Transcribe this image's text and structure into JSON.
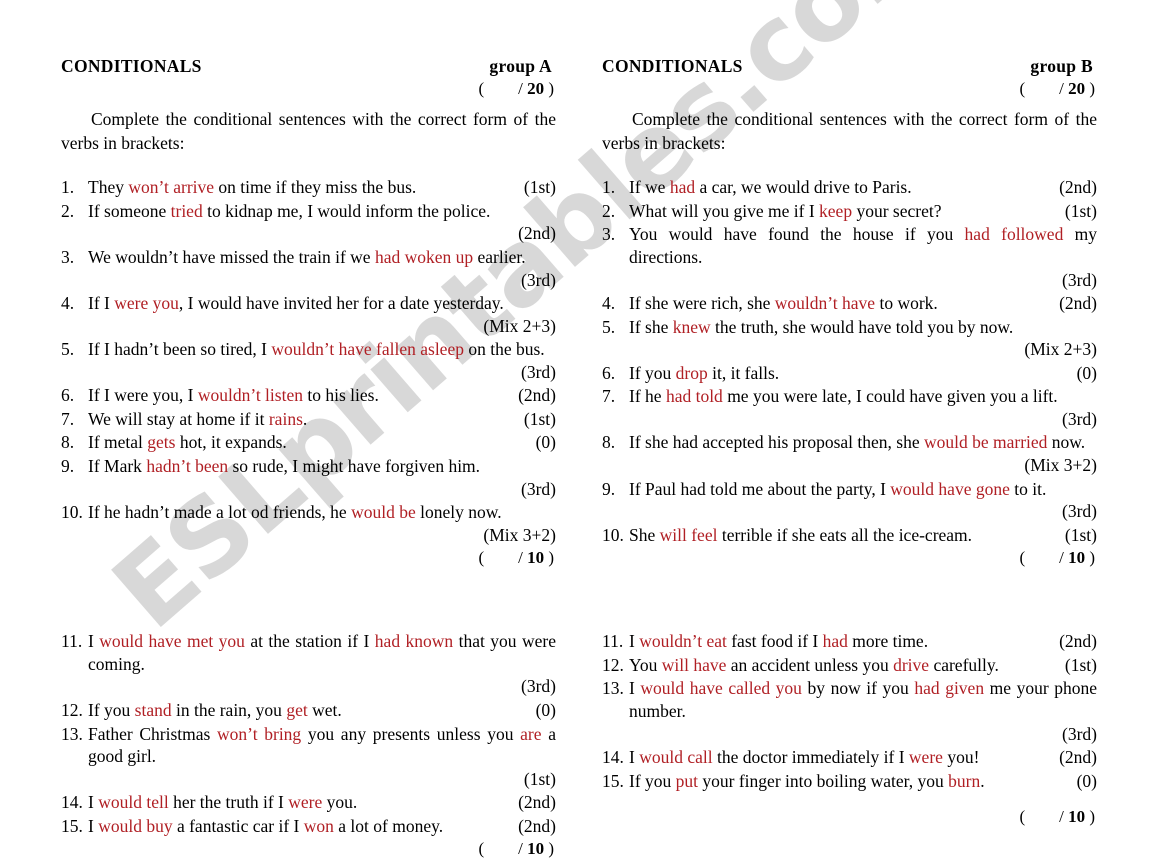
{
  "watermark": {
    "text": "ESLprintables.com"
  },
  "colors": {
    "answer_red": "#b01f24",
    "text_black": "#000000",
    "watermark_gray": "#d2d2d2"
  },
  "columns": [
    {
      "id": "group-a",
      "title": "CONDITIONALS",
      "group_label": "group A",
      "total_score": "(        / 20 )",
      "total_score_prefix": "(        / ",
      "total_score_num": "20",
      "total_score_suffix": " )",
      "instructions": "Complete the conditional sentences with the correct form of the verbs in brackets:",
      "block1": {
        "items": [
          {
            "num": "1.",
            "layout": "single",
            "text_html": "They <span class='ans'>won’t arrive</span> on time if they miss the bus.",
            "tag": "(1st)"
          },
          {
            "num": "2.",
            "layout": "wrap",
            "text_html": "If someone <span class='ans'>tried</span> to kidnap me, I would inform the police.",
            "tag": "(2nd)"
          },
          {
            "num": "3.",
            "layout": "wrap",
            "text_html": "We wouldn’t have missed the train if we <span class='ans'>had woken up</span> earlier.",
            "tag": "(3rd)"
          },
          {
            "num": "4.",
            "layout": "wrap",
            "text_html": "If I <span class='ans'>were you</span>, I would have invited her for a date yesterday.",
            "tag": "(Mix 2+3)"
          },
          {
            "num": "5.",
            "layout": "wrap",
            "text_html": "If I hadn’t been so tired, I <span class='ans'>wouldn’t have fallen asleep</span> on the bus.",
            "tag": "(3rd)"
          },
          {
            "num": "6.",
            "layout": "single",
            "text_html": "If I were you, I <span class='ans'>wouldn’t listen</span> to his lies.",
            "tag": "(2nd)"
          },
          {
            "num": "7.",
            "layout": "single",
            "text_html": "We will stay at home if it <span class='ans'>rains</span>.",
            "tag": "(1st)"
          },
          {
            "num": "8.",
            "layout": "single",
            "text_html": "If metal <span class='ans'>gets</span> hot, it expands.",
            "tag": "(0)"
          },
          {
            "num": "9.",
            "layout": "wrap",
            "text_html": "If Mark <span class='ans'>hadn’t been</span> so rude, I might have forgiven him.",
            "tag": "(3rd)"
          },
          {
            "num": "10.",
            "layout": "wrap",
            "text_html": "If he hadn’t made a lot od friends, he <span class='ans'>would be</span> lonely now.",
            "tag": "(Mix 3+2)"
          }
        ],
        "score": "(        / 10 )",
        "score_prefix": "(        / ",
        "score_num": "10",
        "score_suffix": " )"
      },
      "block2": {
        "items": [
          {
            "num": "11.",
            "layout": "wrap",
            "text_html": "I <span class='ans'>would have met you</span> at the station if I <span class='ans'>had known</span> that you were coming.",
            "tag": "(3rd)"
          },
          {
            "num": "12.",
            "layout": "single",
            "text_html": "If you <span class='ans'>stand</span> in the rain, you <span class='ans'>get</span> wet.",
            "tag": "(0)"
          },
          {
            "num": "13.",
            "layout": "wrap",
            "text_html": "Father Christmas <span class='ans'>won’t bring</span> you any presents unless you <span class='ans'>are</span> a good girl.",
            "tag": "(1st)"
          },
          {
            "num": "14.",
            "layout": "single",
            "text_html": "I <span class='ans'>would tell</span> her the truth if I <span class='ans'>were</span> you.",
            "tag": "(2nd)"
          },
          {
            "num": "15.",
            "layout": "single",
            "text_html": "I <span class='ans'>would buy</span> a fantastic car if I <span class='ans'>won</span> a lot of money.",
            "tag": "(2nd)"
          }
        ],
        "score": "(        / 10 )",
        "score_prefix": "(        / ",
        "score_num": "10",
        "score_suffix": " )"
      }
    },
    {
      "id": "group-b",
      "title": "CONDITIONALS",
      "group_label": "group B",
      "total_score": "(        / 20 )",
      "total_score_prefix": "(        / ",
      "total_score_num": "20",
      "total_score_suffix": " )",
      "instructions": "Complete the conditional sentences with the correct form of the verbs in brackets:",
      "block1": {
        "items": [
          {
            "num": "1.",
            "layout": "single",
            "text_html": "If we <span class='ans'>had</span> a car, we would drive to Paris.",
            "tag": "(2nd)"
          },
          {
            "num": "2.",
            "layout": "single",
            "text_html": "What will you give me if I <span class='ans'>keep</span> your secret?",
            "tag": "(1st)"
          },
          {
            "num": "3.",
            "layout": "wrap",
            "text_html": "You would have found the house if you <span class='ans'>had followed</span> my directions.",
            "tag": "(3rd)"
          },
          {
            "num": "4.",
            "layout": "single",
            "text_html": "If she were rich, she <span class='ans'>wouldn’t have</span> to work.",
            "tag": "(2nd)"
          },
          {
            "num": "5.",
            "layout": "wrap",
            "text_html": "If she <span class='ans'>knew</span> the truth, she would have told you by now.",
            "tag": "(Mix 2+3)"
          },
          {
            "num": "6.",
            "layout": "single",
            "text_html": "If you <span class='ans'>drop</span> it, it falls.",
            "tag": "(0)"
          },
          {
            "num": "7.",
            "layout": "wrap",
            "text_html": "If he <span class='ans'>had told</span> me you were late, I could have given you a lift.",
            "tag": "(3rd)"
          },
          {
            "num": "8.",
            "layout": "wrap",
            "text_html": "If she had accepted his proposal then, she <span class='ans'>would be married</span> now.",
            "tag": "(Mix 3+2)"
          },
          {
            "num": "9.",
            "layout": "wrap",
            "text_html": "If Paul had told me about the party, I <span class='ans'>would have gone</span> to it.",
            "tag": "(3rd)"
          },
          {
            "num": "10.",
            "layout": "single",
            "text_html": "She <span class='ans'>will feel</span> terrible if she eats all the ice-cream.",
            "tag": "(1st)"
          }
        ],
        "score": "(        / 10 )",
        "score_prefix": "(        / ",
        "score_num": "10",
        "score_suffix": " )"
      },
      "block2": {
        "items": [
          {
            "num": "11.",
            "layout": "single",
            "text_html": "I <span class='ans'>wouldn’t eat</span> fast food if I <span class='ans'>had</span> more time.",
            "tag": "(2nd)"
          },
          {
            "num": "12.",
            "layout": "single",
            "text_html": "You <span class='ans'>will have</span> an accident unless you <span class='ans'>drive</span> carefully.",
            "tag": "(1st)"
          },
          {
            "num": "13.",
            "layout": "wrap",
            "text_html": "I <span class='ans'>would have called you</span> by now if you <span class='ans'>had given</span> me your phone number.",
            "tag": "(3rd)"
          },
          {
            "num": "14.",
            "layout": "single",
            "text_html": "I <span class='ans'>would call</span> the doctor immediately if I <span class='ans'>were</span> you!",
            "tag": "(2nd)"
          },
          {
            "num": "15.",
            "layout": "single",
            "text_html": "If you <span class='ans'>put</span> your finger into boiling water, you <span class='ans'>burn</span>.",
            "tag": "(0)"
          }
        ],
        "score": "(        / 10 )",
        "score_prefix": "(        / ",
        "score_num": "10",
        "score_suffix": " )"
      }
    }
  ]
}
